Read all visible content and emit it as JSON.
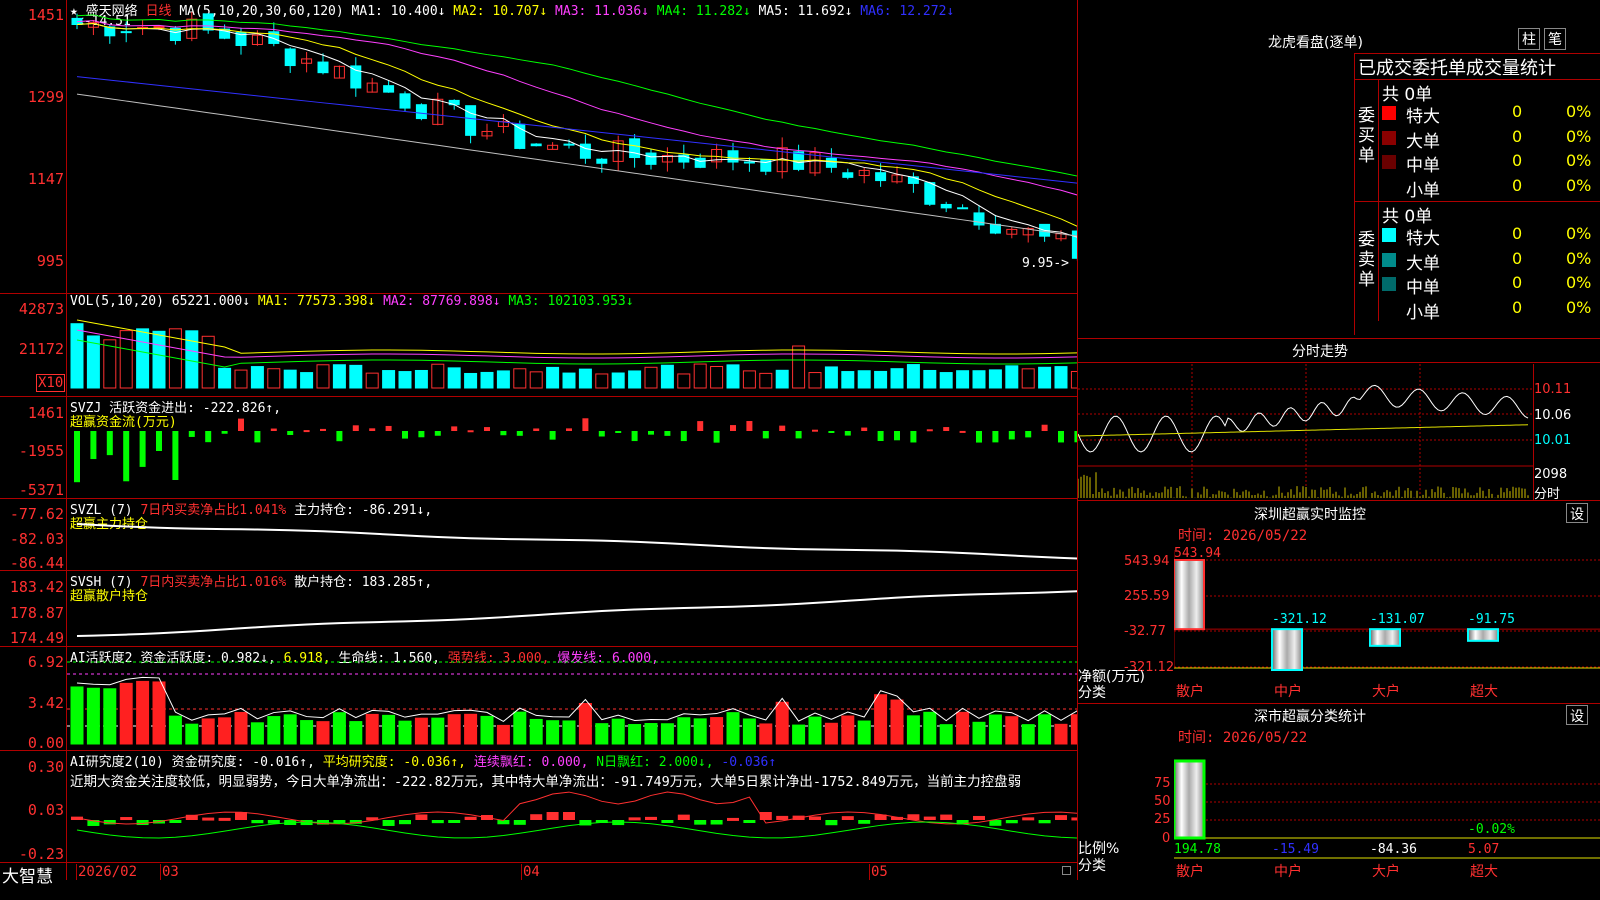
{
  "main": {
    "stock_name": "盛天网络",
    "period": "日线",
    "ma_label": "MA(5,10,20,30,60,120)",
    "ma1": "MA1: 10.400↓",
    "ma2": "MA2: 10.707↓",
    "ma3": "MA3: 11.036↓",
    "ma4": "MA4: 11.282↓",
    "ma5": "MA5: 11.692↓",
    "ma6": "MA6: 12.272↓",
    "high_mark": "14.51",
    "low_mark": "9.95",
    "y_ticks": [
      "1451",
      "1299",
      "1147",
      "995"
    ]
  },
  "vol": {
    "title": "VOL(5,10,20)",
    "value": "65221.000↓",
    "ma1": "MA1: 77573.398↓",
    "ma2": "MA2: 87769.898↓",
    "ma3": "MA3: 102103.953↓",
    "y_ticks": [
      "42873",
      "21172"
    ],
    "unit": "X10"
  },
  "svzj": {
    "title": "SVZJ",
    "text1": "活跃资金进出: -222.826↑,",
    "text2": "超赢资金流(万元)",
    "y_ticks": [
      "1461",
      "-1955",
      "-5371"
    ]
  },
  "svzl": {
    "title": "SVZL (7)",
    "text1": "7日内买卖净占比1.041%",
    "text2": "主力持仓: -86.291↓,",
    "text3": "超赢主力持仓",
    "y_ticks": [
      "-77.62",
      "-82.03",
      "-86.44"
    ]
  },
  "svsh": {
    "title": "SVSH (7)",
    "text1": "7日内买卖净占比1.016%",
    "text2": "散户持仓: 183.285↑,",
    "text3": "超赢散户持仓",
    "y_ticks": [
      "183.42",
      "178.87",
      "174.49"
    ]
  },
  "ai1": {
    "title": "AI活跃度2",
    "t1": "资金活跃度: 0.982↓,",
    "t2": "6.918,",
    "t3": "生命线: 1.560,",
    "t4": "强势线: 3.000,",
    "t5": "爆发线: 6.000,",
    "y_ticks": [
      "6.92",
      "3.42",
      "0.00"
    ]
  },
  "ai2": {
    "title": "AI研究度2(10)",
    "t1": "资金研究度: -0.016↑,",
    "t2": "平均研究度: -0.036↑,",
    "t3": "连续飘红: 0.000,",
    "t4": "N日飘红: 2.000↓,",
    "t5": "-0.036↑",
    "comment": "近期大资金关注度较低，明显弱势，今日大单净流出：-222.82万元，其中特大单净流出：-91.749万元，大单5日累计净出-1752.849万元，当前主力控盘弱",
    "y_ticks": [
      "0.30",
      "0.03",
      "-0.23"
    ]
  },
  "footer": {
    "brand": "大智慧",
    "dates": [
      "2026/02",
      "03",
      "04",
      "05"
    ]
  },
  "right": {
    "dragon_title": "龙虎看盘(逐单)",
    "btn_col": "柱",
    "btn_tick": "笔",
    "section_title": "已成交委托单成交量统计",
    "buy": {
      "label": "委买单",
      "total": "共 0单",
      "rows": [
        {
          "name": "特大",
          "vol": "0",
          "pct": "0%",
          "color": "#ff0000"
        },
        {
          "name": "大单",
          "vol": "0",
          "pct": "0%",
          "color": "#8b0000"
        },
        {
          "name": "中单",
          "vol": "0",
          "pct": "0%",
          "color": "#6a0000"
        },
        {
          "name": "小单",
          "vol": "0",
          "pct": "0%",
          "color": "#000000"
        }
      ]
    },
    "sell": {
      "label": "委卖单",
      "total": "共 0单",
      "rows": [
        {
          "name": "特大",
          "vol": "0",
          "pct": "0%",
          "color": "#00ffff"
        },
        {
          "name": "大单",
          "vol": "0",
          "pct": "0%",
          "color": "#008b8b"
        },
        {
          "name": "中单",
          "vol": "0",
          "pct": "0%",
          "color": "#006a6a"
        },
        {
          "name": "小单",
          "vol": "0",
          "pct": "0%",
          "color": "#000000"
        }
      ]
    },
    "intraday": {
      "title": "分时走势",
      "y_ticks": [
        "10.11",
        "10.06",
        "10.01"
      ],
      "vol_tick": "2098",
      "vol_unit": "分时"
    },
    "monitor": {
      "title": "深圳超赢实时监控",
      "setting": "设",
      "time": "时间: 2026/05/22",
      "y_ticks": [
        "543.94",
        "255.59",
        "-32.77",
        "-321.12"
      ],
      "ylabel": "净额(万元)",
      "xlabel": "分类",
      "cats": [
        "散户",
        "中户",
        "大户",
        "超大"
      ],
      "values": [
        "543.94",
        "-321.12",
        "-131.07",
        "-91.75"
      ]
    },
    "classify": {
      "title": "深市超赢分类统计",
      "setting": "设",
      "time": "时间: 2026/05/22",
      "y_ticks": [
        "75",
        "50",
        "25",
        "0"
      ],
      "ylabel": "比例%",
      "xlabel": "分类",
      "cats": [
        "散户",
        "中户",
        "大户",
        "超大"
      ],
      "values": [
        "194.78",
        "-15.49",
        "-84.36",
        "5.07"
      ],
      "extra": "-0.02%"
    }
  }
}
